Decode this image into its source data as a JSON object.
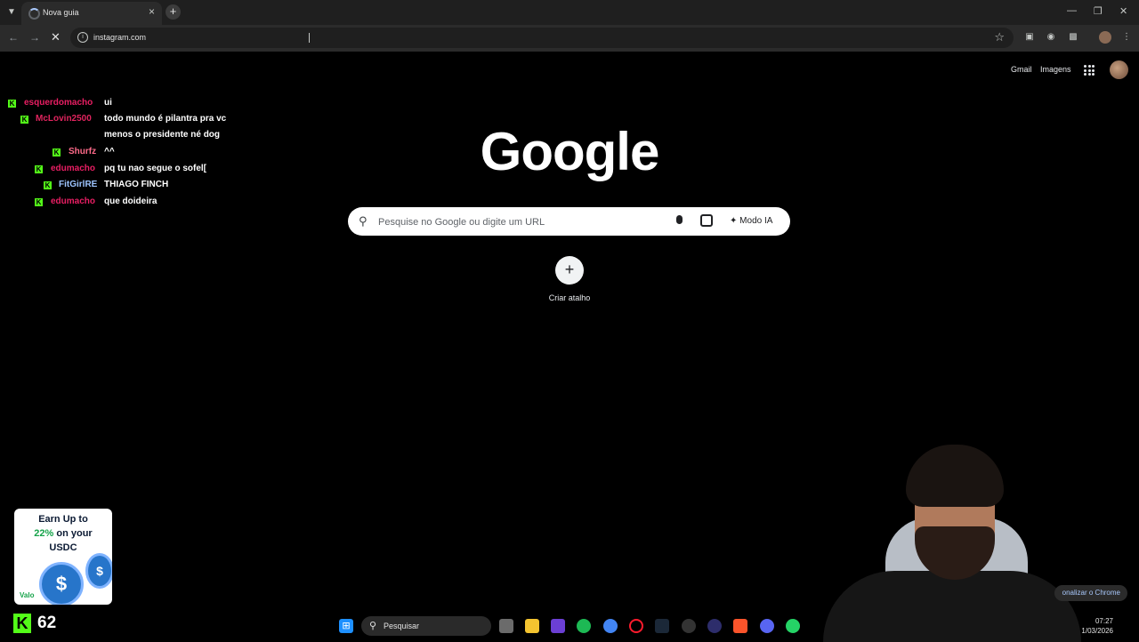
{
  "browser": {
    "tab_title": "Nova guia",
    "address": "instagram.com"
  },
  "google": {
    "links": [
      "Gmail",
      "Imagens"
    ],
    "logo": "Google",
    "search_placeholder": "Pesquise no Google ou digite um URL",
    "ai_mode": "Modo IA",
    "shortcut_label": "Criar atalho",
    "customize": "onalizar o Chrome"
  },
  "chat": [
    {
      "user": "esquerdomacho",
      "text": "ui",
      "color": "#e91e63"
    },
    {
      "user": "McLovin2500",
      "text": "todo mundo é pilantra pra vc menos o presidente né dog",
      "color": "#e0245e"
    },
    {
      "user": "Shurfz",
      "text": "^^",
      "color": "#ff6b8a"
    },
    {
      "user": "edumacho",
      "text": "pq tu nao segue o sofel[",
      "color": "#e91e63"
    },
    {
      "user": "FitGirlRE",
      "text": "THIAGO FINCH",
      "color": "#9ec5ff"
    },
    {
      "user": "edumacho",
      "text": "que doideira",
      "color": "#e91e63"
    }
  ],
  "ad": {
    "line1": "Earn Up to",
    "accent": "22%",
    "line2_rest": " on your",
    "line3": "USDC",
    "brand": "Valo"
  },
  "stream": {
    "viewers": "62"
  },
  "taskbar": {
    "search_label": "Pesquisar",
    "time": "07:27",
    "date": "1/03/2026"
  }
}
